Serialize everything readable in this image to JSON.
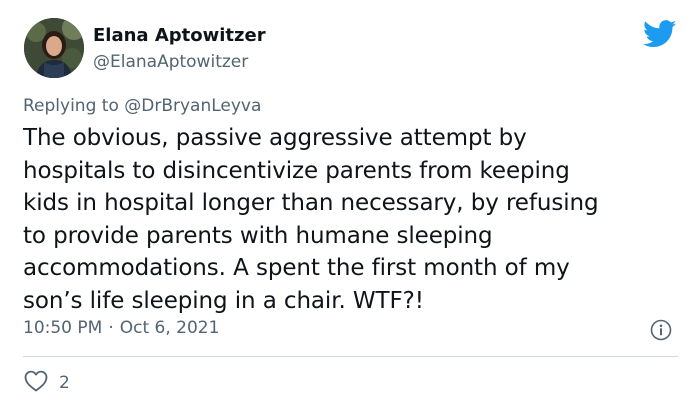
{
  "author": {
    "name": "Elana Aptowitzer",
    "handle": "@ElanaAptowitzer",
    "avatar_icon": "user-avatar"
  },
  "brand": {
    "icon": "twitter-bird-icon",
    "color": "#1d9bf0"
  },
  "reply": {
    "prefix": "Replying to",
    "mention": "@DrBryanLeyva"
  },
  "tweet": {
    "lines": [
      "The obvious, passive aggressive attempt by",
      "hospitals to disincentivize parents from keeping",
      "kids in hospital longer than necessary, by refusing",
      "to provide parents with humane sleeping",
      "accommodations. A spent the first month of my",
      "son’s life sleeping in a chair. WTF?!"
    ]
  },
  "meta": {
    "time": "10:50 PM",
    "separator": "·",
    "date": "Oct 6, 2021",
    "info_icon": "info-icon"
  },
  "engagement": {
    "like_icon": "heart-icon",
    "likes": "2"
  },
  "colors": {
    "text": "#0f1419",
    "secondary": "#536471",
    "divider": "#cfd9de"
  }
}
